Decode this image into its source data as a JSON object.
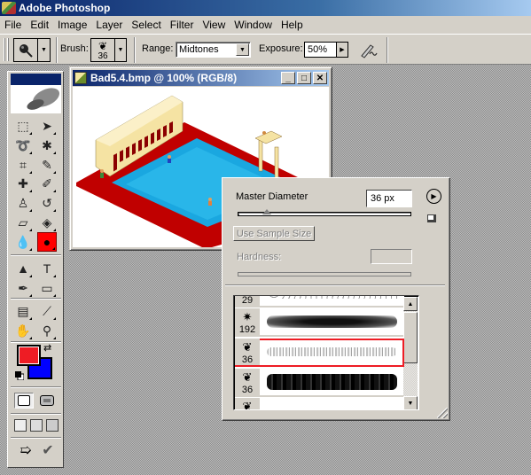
{
  "app": {
    "title": "Adobe Photoshop",
    "icon": "photoshop-feather-icon"
  },
  "menubar": {
    "items": [
      "File",
      "Edit",
      "Image",
      "Layer",
      "Select",
      "Filter",
      "View",
      "Window",
      "Help"
    ]
  },
  "options_bar": {
    "tool_preset_icon": "burn-tool-icon",
    "brush_label": "Brush:",
    "brush_size": "36",
    "range_label": "Range:",
    "range_value": "Midtones",
    "exposure_label": "Exposure:",
    "exposure_value": "50%",
    "airbrush_icon": "airbrush-icon"
  },
  "toolbox": {
    "tools": [
      {
        "name": "marquee",
        "glyph": "⬚"
      },
      {
        "name": "move",
        "glyph": "➤"
      },
      {
        "name": "lasso",
        "glyph": "➰"
      },
      {
        "name": "magic-wand",
        "glyph": "✱"
      },
      {
        "name": "crop",
        "glyph": "⌗"
      },
      {
        "name": "slice",
        "glyph": "✎"
      },
      {
        "name": "healing-brush",
        "glyph": "✚"
      },
      {
        "name": "brush",
        "glyph": "✐"
      },
      {
        "name": "clone-stamp",
        "glyph": "♙"
      },
      {
        "name": "history-brush",
        "glyph": "↺"
      },
      {
        "name": "eraser",
        "glyph": "▱"
      },
      {
        "name": "paint-bucket",
        "glyph": "◈"
      },
      {
        "name": "blur",
        "glyph": "💧"
      },
      {
        "name": "burn",
        "glyph": "●",
        "active": true
      },
      {
        "name": "path-selection",
        "glyph": "▲"
      },
      {
        "name": "type",
        "glyph": "T"
      },
      {
        "name": "pen",
        "glyph": "✒"
      },
      {
        "name": "rectangle",
        "glyph": "▭"
      },
      {
        "name": "notes",
        "glyph": "▤"
      },
      {
        "name": "eyedropper",
        "glyph": "⟋"
      },
      {
        "name": "hand",
        "glyph": "✋"
      },
      {
        "name": "zoom",
        "glyph": "⚲"
      }
    ],
    "foreground_color": "#ee1c24",
    "background_color": "#0000ff"
  },
  "document": {
    "title": "Bad5.4.bmp @ 100% (RGB/8)",
    "minimize": "_",
    "maximize": "□",
    "close": "✕"
  },
  "brush_panel": {
    "master_diameter_label": "Master Diameter",
    "master_diameter_value": "36 px",
    "master_diameter_fraction": 0.17,
    "use_sample_size_label": "Use Sample Size",
    "hardness_label": "Hardness:",
    "brushes": [
      {
        "size": "29",
        "glyph": "☆",
        "stroke": "stars"
      },
      {
        "size": "192",
        "glyph": "✷",
        "stroke": "soft-dark"
      },
      {
        "size": "36",
        "glyph": "❦",
        "stroke": "speckled-light",
        "selected": true
      },
      {
        "size": "36",
        "glyph": "❦",
        "stroke": "rough-dark"
      },
      {
        "size": "",
        "glyph": "❦",
        "stroke": "dotted"
      }
    ],
    "highlight_color": "#ee1c24"
  }
}
